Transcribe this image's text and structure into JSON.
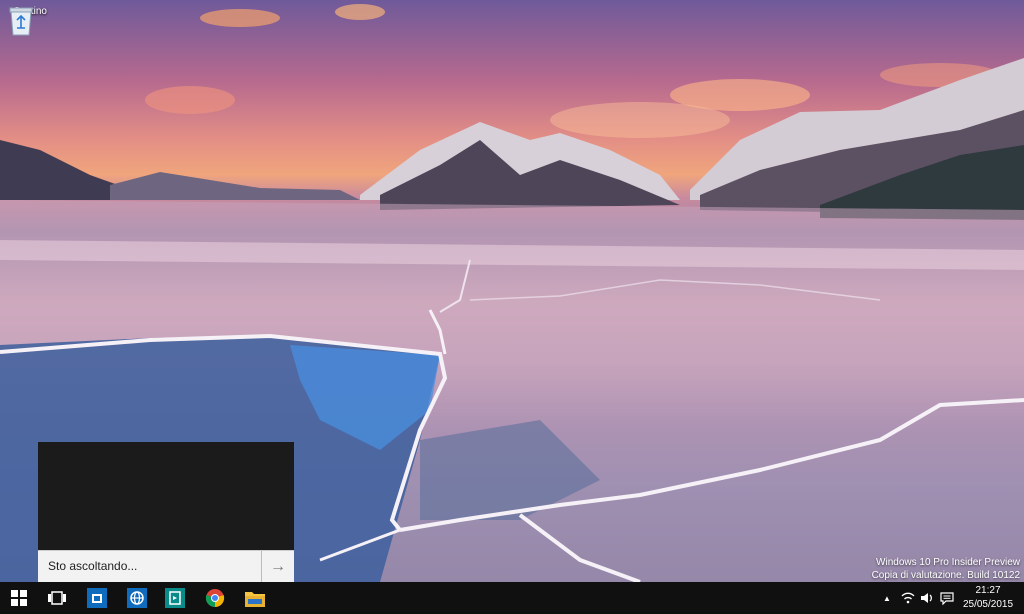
{
  "desktop": {
    "recycle_bin_label": "Cestino",
    "watermark": {
      "line1": "Windows 10 Pro Insider Preview",
      "line2": "Copia di valutazione. Build 10122"
    }
  },
  "cortana": {
    "input_text": "Sto ascoltando...",
    "submit_icon": "arrow-right-icon"
  },
  "taskbar": {
    "buttons": [
      {
        "name": "start-button",
        "icon": "windows-logo-icon"
      },
      {
        "name": "task-view-button",
        "icon": "task-view-icon"
      },
      {
        "name": "store-button",
        "icon": "store-icon"
      },
      {
        "name": "edge-button",
        "icon": "spartan-browser-icon"
      },
      {
        "name": "app-button",
        "icon": "app-icon"
      },
      {
        "name": "chrome-button",
        "icon": "chrome-icon"
      },
      {
        "name": "file-explorer-button",
        "icon": "folder-icon"
      }
    ],
    "tray": {
      "chevron": "▲",
      "icons": [
        "network-icon",
        "volume-icon",
        "notification-icon"
      ]
    },
    "clock": {
      "time": "21:27",
      "date": "25/05/2015"
    }
  },
  "colors": {
    "taskbar_bg": "#101010",
    "accent_blue": "#0f6cbd",
    "cortana_bg": "#1b1b1b"
  }
}
